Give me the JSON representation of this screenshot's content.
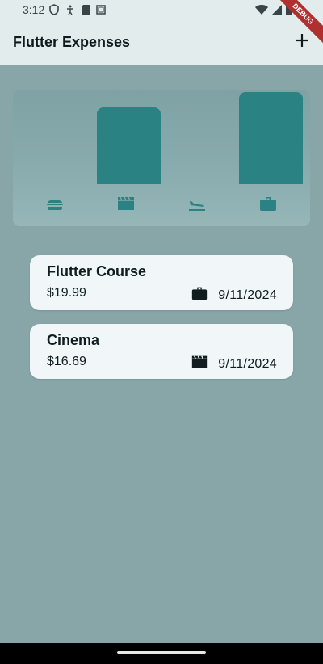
{
  "status_bar": {
    "time": "3:12",
    "left_icons": [
      "shield-icon",
      "accessibility-icon",
      "sd-card-icon",
      "screen-icon"
    ],
    "right_icons": [
      "wifi-icon",
      "signal-icon",
      "battery-icon"
    ]
  },
  "debug_banner": "DEBUG",
  "app_bar": {
    "title": "Flutter Expenses",
    "add_icon": "plus-icon"
  },
  "chart_data": {
    "type": "bar",
    "categories": [
      "food",
      "leisure",
      "travel",
      "work"
    ],
    "category_icons": [
      "burger-icon",
      "clapperboard-icon",
      "flight-icon",
      "briefcase-icon"
    ],
    "values": [
      0,
      16.69,
      0,
      19.99
    ],
    "bar_color": "#2a8283",
    "title": "",
    "xlabel": "",
    "ylabel": ""
  },
  "expenses": [
    {
      "title": "Flutter Course",
      "amount": "$19.99",
      "category_icon": "briefcase-icon",
      "date": "9/11/2024"
    },
    {
      "title": "Cinema",
      "amount": "$16.69",
      "category_icon": "clapperboard-icon",
      "date": "9/11/2024"
    }
  ],
  "colors": {
    "background": "#88a6a8",
    "app_bar": "#e2eced",
    "card": "#f1f6f8",
    "accent": "#2a8283",
    "text": "#111c1e"
  }
}
